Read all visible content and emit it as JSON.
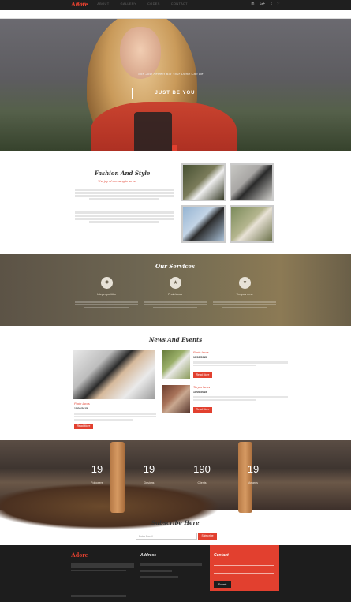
{
  "brand": "Adore",
  "social": [
    "in",
    "G+",
    "t",
    "f"
  ],
  "nav": [
    "HOME",
    "ABOUT",
    "GALLERY",
    "CODES",
    "CONTACT"
  ],
  "hero": {
    "tagline": "Site Just Perfect But Your Outfit Can Be",
    "button": "JUST BE YOU"
  },
  "fashion": {
    "title": "Fashion And Style",
    "subtitle": "The joy of dressing is an art"
  },
  "services": {
    "title": "Our Services",
    "items": [
      {
        "icon": "gear-icon",
        "glyph": "✹",
        "title": "Integer porttitor"
      },
      {
        "icon": "star-icon",
        "glyph": "★",
        "title": "Proin lacus"
      },
      {
        "icon": "heart-icon",
        "glyph": "♥",
        "title": "Tempus urna"
      }
    ]
  },
  "news": {
    "title": "News And Events",
    "main": {
      "title": "Proin lacus",
      "date": "10/03/2015",
      "button": "Read More"
    },
    "items": [
      {
        "title": "Proin lacus",
        "date": "10/03/2015",
        "button": "Read More"
      },
      {
        "title": "Turpis lacus",
        "date": "10/03/2015",
        "button": "Read More"
      }
    ]
  },
  "stats": [
    {
      "value": "19",
      "label": "Followers"
    },
    {
      "value": "19",
      "label": "Designs"
    },
    {
      "value": "190",
      "label": "Clients"
    },
    {
      "value": "19",
      "label": "Awards"
    }
  ],
  "subscribe": {
    "title": "Subscribe Here",
    "placeholder": "Enter Email...",
    "button": "Subscribe"
  },
  "footer": {
    "brand": "Adore",
    "address_title": "Address",
    "contact_title": "Contact",
    "submit": "Submit"
  },
  "colors": {
    "accent": "#e2402f",
    "dark": "#1d1d1d"
  }
}
